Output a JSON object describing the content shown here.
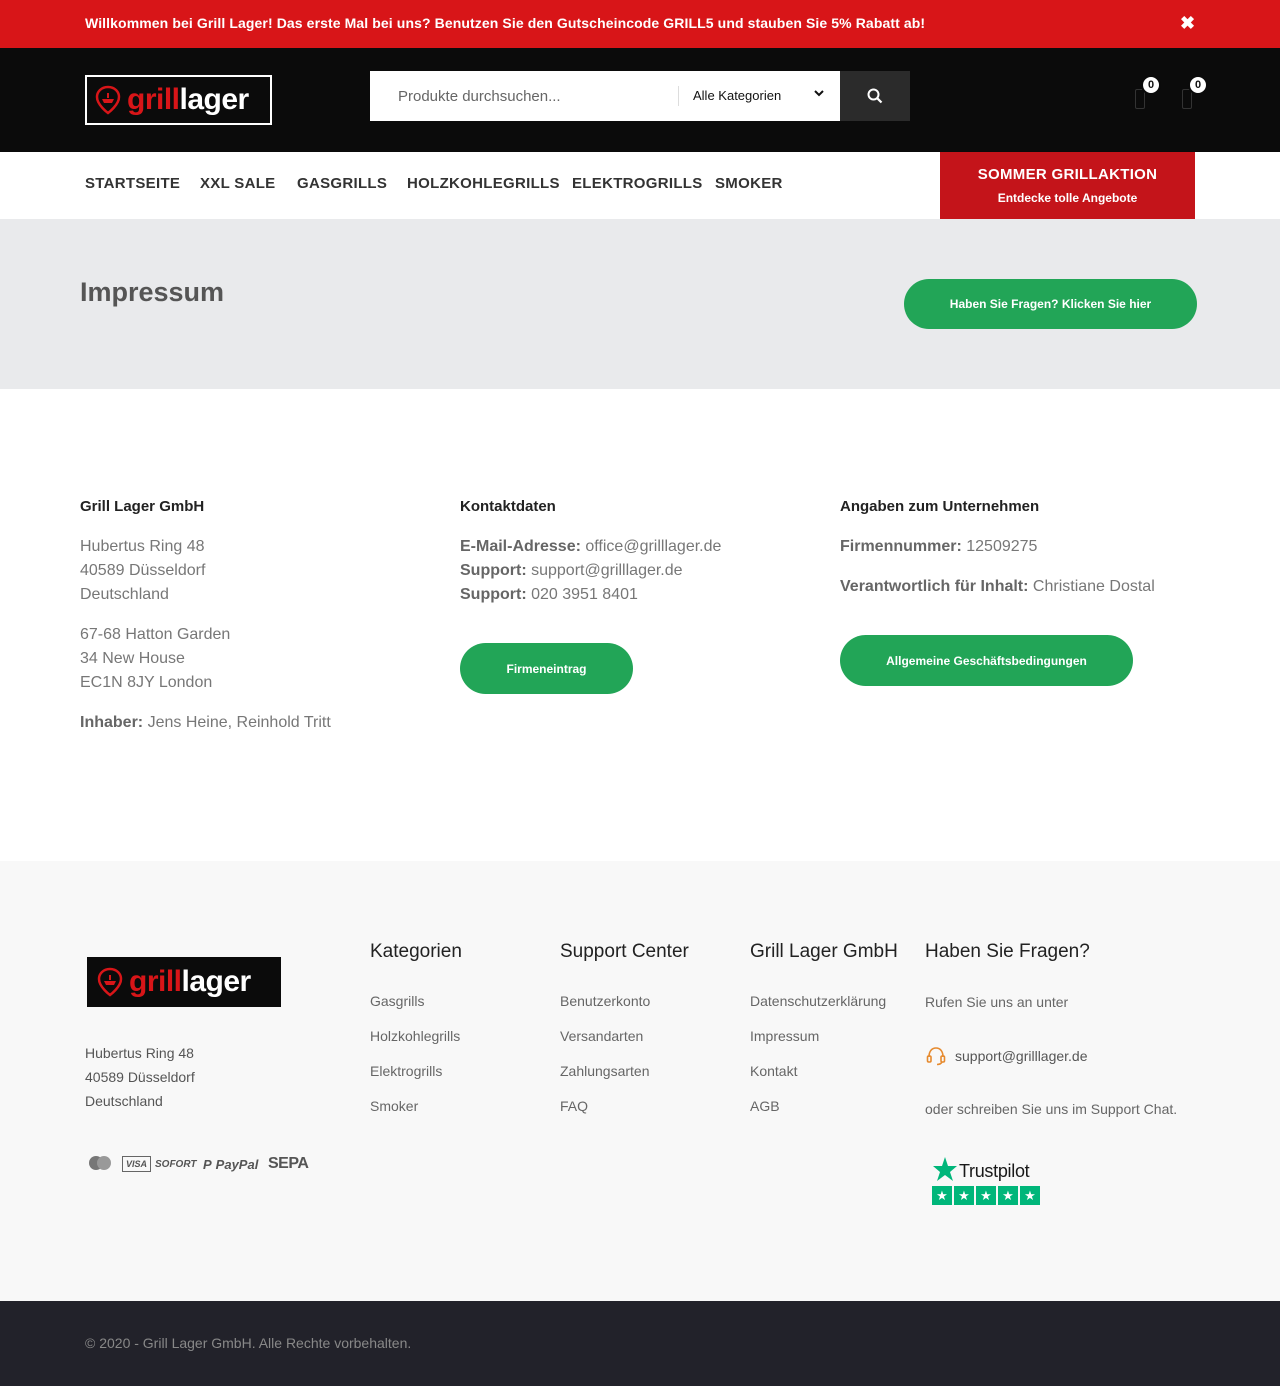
{
  "topbar": {
    "message": "Willkommen bei Grill Lager! Das erste Mal bei uns? Benutzen Sie den Gutscheincode GRILL5 und stauben Sie 5% Rabatt ab!",
    "close": "✖"
  },
  "header": {
    "logo_part1": "grill",
    "logo_part2": "lager",
    "search_placeholder": "Produkte durchsuchen...",
    "category_select": "Alle Kategorien",
    "wishlist_count": "0",
    "cart_count": "0"
  },
  "nav": {
    "items": [
      "STARTSEITE",
      "XXL SALE",
      "GASGRILLS",
      "HOLZKOHLEGRILLS",
      "ELEKTROGRILLS",
      "SMOKER"
    ],
    "promo_title": "SOMMER GRILLAKTION",
    "promo_subtitle": "Entdecke tolle Angebote"
  },
  "page": {
    "title": "Impressum",
    "question_button": "Haben Sie Fragen? Klicken Sie hier"
  },
  "company": {
    "heading": "Grill Lager GmbH",
    "address1": [
      "Hubertus Ring 48",
      "40589 Düsseldorf",
      "Deutschland"
    ],
    "address2": [
      "67-68 Hatton Garden",
      "34 New House",
      "EC1N 8JY London"
    ],
    "owner_label": "Inhaber:",
    "owner_value": "Jens Heine, Reinhold Tritt"
  },
  "contact": {
    "heading": "Kontaktdaten",
    "email_label": "E-Mail-Adresse:",
    "email_value": "office@grilllager.de",
    "support_label": "Support:",
    "support_email": "support@grilllager.de",
    "support_phone_label": "Support:",
    "support_phone": "020 3951 8401",
    "button": "Firmeneintrag"
  },
  "business": {
    "heading": "Angaben zum Unternehmen",
    "number_label": "Firmennummer:",
    "number_value": "12509275",
    "responsible_label": "Verantwortlich für Inhalt:",
    "responsible_value": "Christiane Dostal",
    "button": "Allgemeine Geschäftsbedingungen"
  },
  "footer": {
    "address": [
      "Hubertus Ring 48",
      "40589 Düsseldorf",
      "Deutschland"
    ],
    "payments": [
      "mastercard",
      "VISA",
      "SOFORT",
      "PayPal",
      "SEPA"
    ],
    "categories": {
      "heading": "Kategorien",
      "links": [
        "Gasgrills",
        "Holzkohlegrills",
        "Elektrogrills",
        "Smoker"
      ]
    },
    "support": {
      "heading": "Support Center",
      "links": [
        "Benutzerkonto",
        "Versandarten",
        "Zahlungsarten",
        "FAQ"
      ]
    },
    "company": {
      "heading": "Grill Lager GmbH",
      "links": [
        "Datenschutzerklärung",
        "Impressum",
        "Kontakt",
        "AGB"
      ]
    },
    "questions": {
      "heading": "Haben Sie Fragen?",
      "call": "Rufen Sie uns an unter",
      "email": "support@grilllager.de",
      "chat": "oder schreiben Sie uns im Support Chat."
    },
    "trustpilot": "Trustpilot",
    "copyright": "© 2020 - Grill Lager GmbH. Alle Rechte vorbehalten."
  },
  "colors": {
    "brand_red": "#d81518",
    "green": "#22a557",
    "trustpilot_green": "#00b67a"
  }
}
